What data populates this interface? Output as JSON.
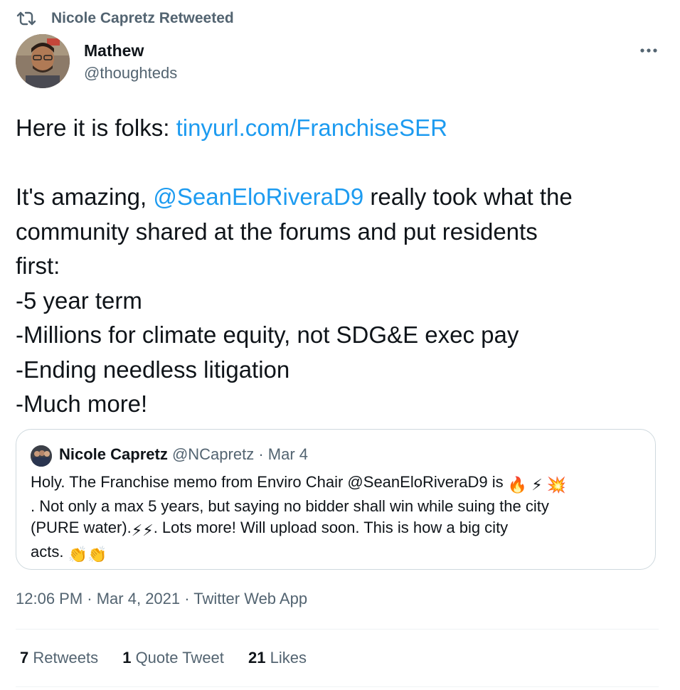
{
  "retweet_header": {
    "text": "Nicole Capretz Retweeted",
    "icon": "retweet-icon"
  },
  "author": {
    "name": "Mathew",
    "handle": "@thoughteds"
  },
  "tweet": {
    "line1_prefix": "Here it is folks: ",
    "line1_link": "tinyurl.com/FranchiseSER",
    "line3_prefix": "It's amazing, ",
    "line3_mention": "@SeanEloRiveraD9",
    "line3_suffix": " really took what the",
    "line4": "community shared at the forums and put residents",
    "line5": "first:",
    "line6": "-5 year term",
    "line7": "-Millions for climate equity, not SDG&E exec pay",
    "line8": "-Ending needless litigation",
    "line9": "-Much more!"
  },
  "quote": {
    "name": "Nicole Capretz",
    "handle": "@NCapretz",
    "separator": " · ",
    "date": "Mar 4",
    "line1": "Holy. The Franchise memo from Enviro Chair @SeanEloRiveraD9 is",
    "emoji1": "🔥 ⚡ 💥",
    "line2": ".  Not only a max 5 years, but saying no bidder shall win while suing the city",
    "line3_text": "(PURE water).",
    "emoji2": "⚡⚡",
    "line3_rest": ".  Lots more! Will upload soon.  This is how a big city",
    "line4_text": "acts. ",
    "emoji3": "👏👏"
  },
  "timestamp": {
    "time": "12:06 PM",
    "separator": " · ",
    "date": "Mar 4, 2021",
    "source": "Twitter Web App"
  },
  "stats": {
    "retweets_count": "7",
    "retweets_label": " Retweets",
    "quotes_count": "1",
    "quotes_label": " Quote Tweet",
    "likes_count": "21",
    "likes_label": " Likes"
  },
  "colors": {
    "link": "#1d9bf0",
    "secondary_text": "#536471",
    "primary_text": "#0f1419",
    "border": "#cfd9de"
  }
}
